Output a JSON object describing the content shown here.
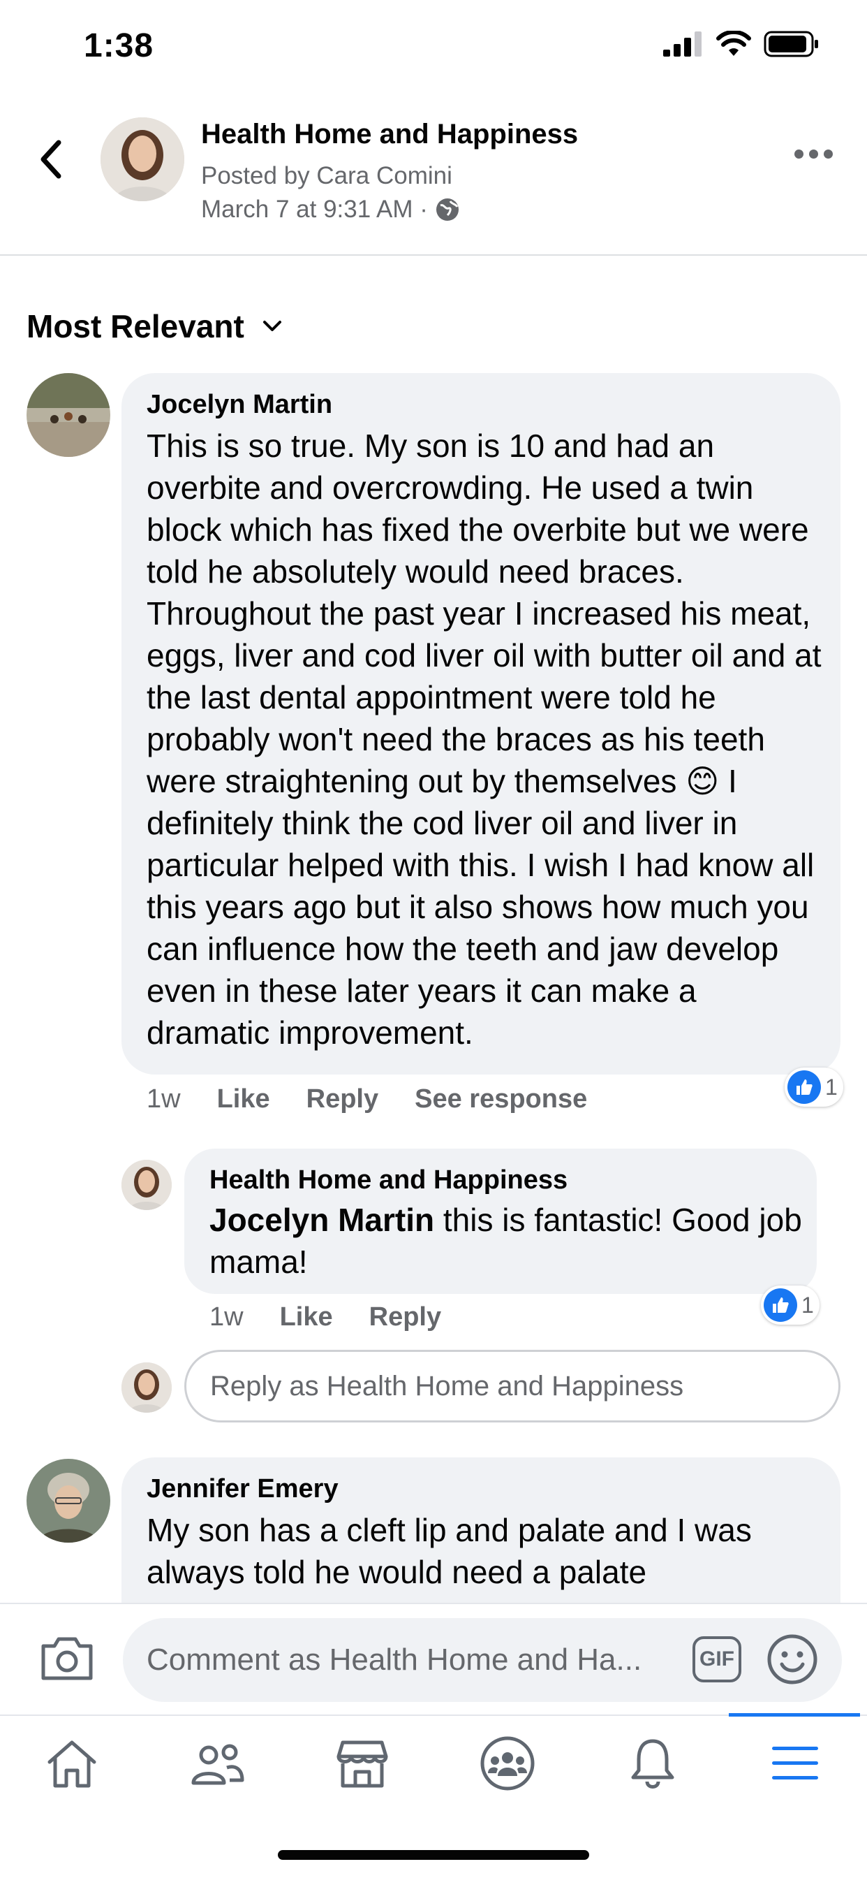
{
  "status_bar": {
    "time": "1:38"
  },
  "header": {
    "title": "Health Home and Happiness",
    "posted_by": "Posted by Cara Comini",
    "date": "March 7 at 9:31 AM ·"
  },
  "sort": {
    "label": "Most Relevant"
  },
  "comments": [
    {
      "author": "Jocelyn Martin",
      "text_part1": "This is so true. My son is 10 and had an overbite and overcrowding. He used a twin block which has fixed the overbite but we were told he absolutely would need braces. Throughout the past year I increased his meat, eggs, liver and cod liver oil with butter oil and at the last dental appointment were told he probably won't need the braces as his teeth were straightening out by",
      "text_part2_start": "themselves",
      "emoji": "😊",
      "text_part2_end": "I definitely think the cod liver oil and liver in particular helped with this. I wish I had know all this years ago but it also shows how much you can influence how the teeth and jaw develop even in these later years it can make a dramatic improvement.",
      "time": "1w",
      "like": "Like",
      "reply": "Reply",
      "see_response": "See response",
      "reaction_count": "1"
    },
    {
      "author": "Jennifer Emery",
      "text": "My son has a cleft lip and palate and I was always told he would need a palate"
    }
  ],
  "reply": {
    "author": "Health Home and Happiness",
    "mention": "Jocelyn Martin",
    "text": " this is fantastic! Good job mama!",
    "time": "1w",
    "like": "Like",
    "reply": "Reply",
    "reaction_count": "1"
  },
  "reply_input": {
    "placeholder": "Reply as Health Home and Happiness"
  },
  "composer": {
    "placeholder": "Comment as Health Home and Ha...",
    "gif": "GIF"
  },
  "nav": {
    "items": [
      "home-icon",
      "friends-icon",
      "marketplace-icon",
      "groups-icon",
      "notifications-icon",
      "menu-icon"
    ],
    "active": "menu-icon",
    "accent": "#1877f2"
  }
}
